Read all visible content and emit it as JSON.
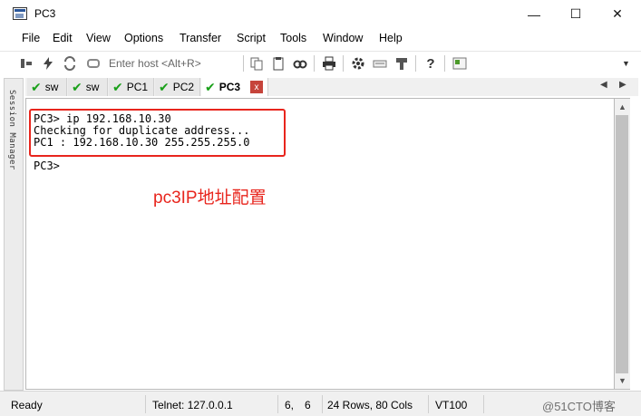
{
  "window": {
    "title": "PC3",
    "minimize_glyph": "—",
    "maximize_glyph": "☐",
    "close_glyph": "✕"
  },
  "menu": [
    "File",
    "Edit",
    "View",
    "Options",
    "Transfer",
    "Script",
    "Tools",
    "Window",
    "Help"
  ],
  "toolbar": {
    "host_placeholder": "Enter host <Alt+R>",
    "icons": [
      "connect-icon",
      "lightning-icon",
      "reconnect-icon",
      "copy-icon",
      "paste-icon",
      "find-icon",
      "print-icon",
      "settings-icon",
      "keymap-icon",
      "sftp-icon",
      "help-icon",
      "screen-icon"
    ]
  },
  "session_manager": {
    "label": "Session Manager"
  },
  "tabs": [
    {
      "label": "sw",
      "active": false
    },
    {
      "label": "sw",
      "active": false
    },
    {
      "label": "PC1",
      "active": false
    },
    {
      "label": "PC2",
      "active": false
    },
    {
      "label": "PC3",
      "active": true
    }
  ],
  "tab_close_glyph": "x",
  "terminal": {
    "lines": [
      "PC3> ip 192.168.10.30",
      "Checking for duplicate address...",
      "PC1 : 192.168.10.30 255.255.255.0",
      "",
      "PC3>"
    ],
    "annotation": "pc3IP地址配置",
    "highlight_color": "#e8251d"
  },
  "status": {
    "state": "Ready",
    "connection": "Telnet: 127.0.0.1",
    "cursor_row": "6,",
    "cursor_col": "6",
    "size": "24 Rows, 80 Cols",
    "emulation": "VT100",
    "watermark": "@51CTO博客"
  }
}
